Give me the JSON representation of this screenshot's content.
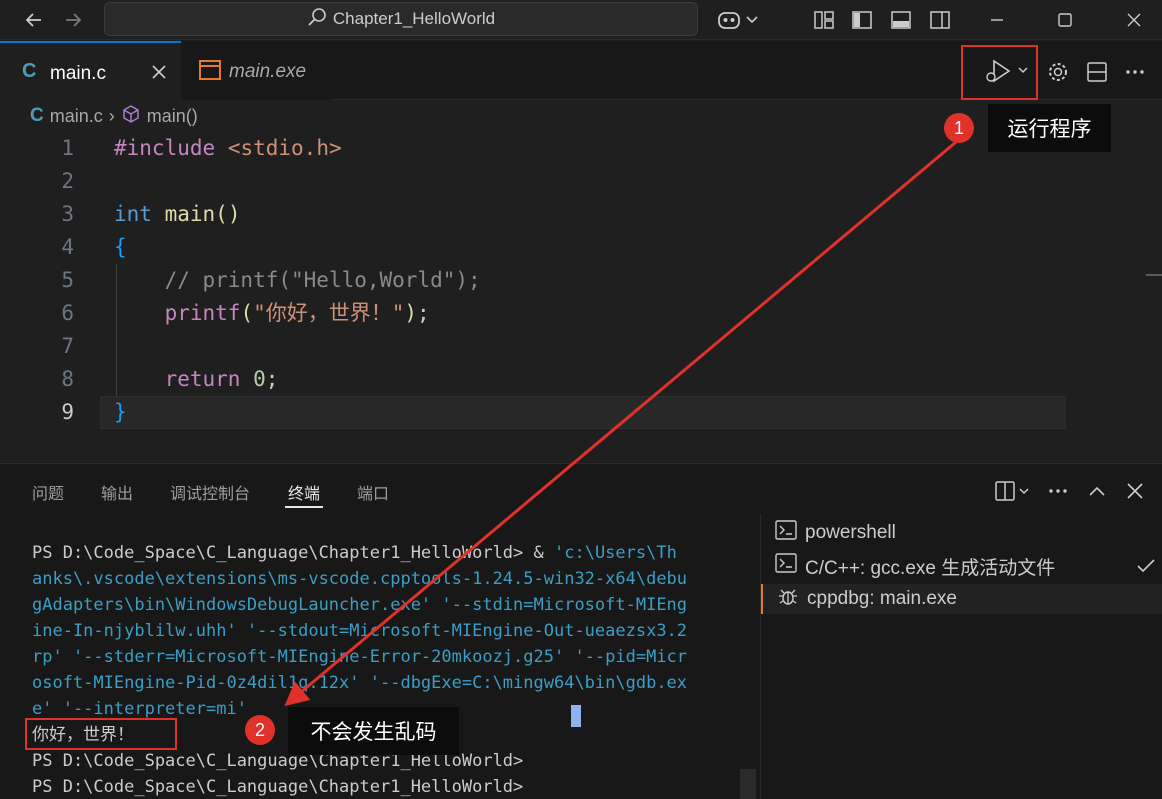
{
  "titlebar": {
    "search_text": "Chapter1_HelloWorld"
  },
  "tabs": [
    {
      "icon": "C",
      "label": "main.c"
    },
    {
      "label": "main.exe"
    }
  ],
  "breadcrumb": {
    "icon": "C",
    "file": "main.c",
    "separator": "›",
    "symbol": "main()"
  },
  "editor": {
    "lines": [
      {
        "n": "1"
      },
      {
        "n": "2"
      },
      {
        "n": "3"
      },
      {
        "n": "4"
      },
      {
        "n": "5"
      },
      {
        "n": "6"
      },
      {
        "n": "7"
      },
      {
        "n": "8"
      },
      {
        "n": "9"
      }
    ],
    "tokens": {
      "include": "#include",
      "header": "<stdio.h>",
      "int": "int",
      "main": "main",
      "parens": "()",
      "open_brace": "{",
      "comment": "// printf(\"Hello,World\");",
      "printf": "printf",
      "paren_open": "(",
      "string": "\"你好，世界！\"",
      "paren_close": ")",
      "semi": ";",
      "return": "return",
      "zero": "0",
      "close_brace": "}"
    }
  },
  "panel": {
    "tabs": [
      "问题",
      "输出",
      "调试控制台",
      "终端",
      "端口"
    ],
    "terminal": {
      "prompt": "PS D:\\Code_Space\\C_Language\\Chapter1_HelloWorld>",
      "cmd_amp": " & ",
      "cmd_lines": [
        "'c:\\Users\\Th",
        "anks\\.vscode\\extensions\\ms-vscode.cpptools-1.24.5-win32-x64\\debu",
        "gAdapters\\bin\\WindowsDebugLauncher.exe' '--stdin=Microsoft-MIEng",
        "ine-In-njyblilw.uhh' '--stdout=Microsoft-MIEngine-Out-ueaezsx3.2",
        "rp' '--stderr=Microsoft-MIEngine-Error-20mkoozj.g25' '--pid=Micr",
        "osoft-MIEngine-Pid-0z4dil1q.12x' '--dbgExe=C:\\mingw64\\bin\\gdb.ex",
        "e' '--interpreter=mi'"
      ],
      "output": "你好，世界！",
      "prompt2": "PS D:\\Code_Space\\C_Language\\Chapter1_HelloWorld>",
      "prompt3": "PS D:\\Code_Space\\C_Language\\Chapter1_HelloWorld>"
    },
    "terminal_list": [
      {
        "label": "powershell"
      },
      {
        "label": "C/C++: gcc.exe 生成活动文件"
      },
      {
        "label": "cppdbg: main.exe"
      }
    ]
  },
  "annotations": [
    {
      "number": "1",
      "label": "运行程序"
    },
    {
      "number": "2",
      "label": "不会发生乱码"
    }
  ]
}
